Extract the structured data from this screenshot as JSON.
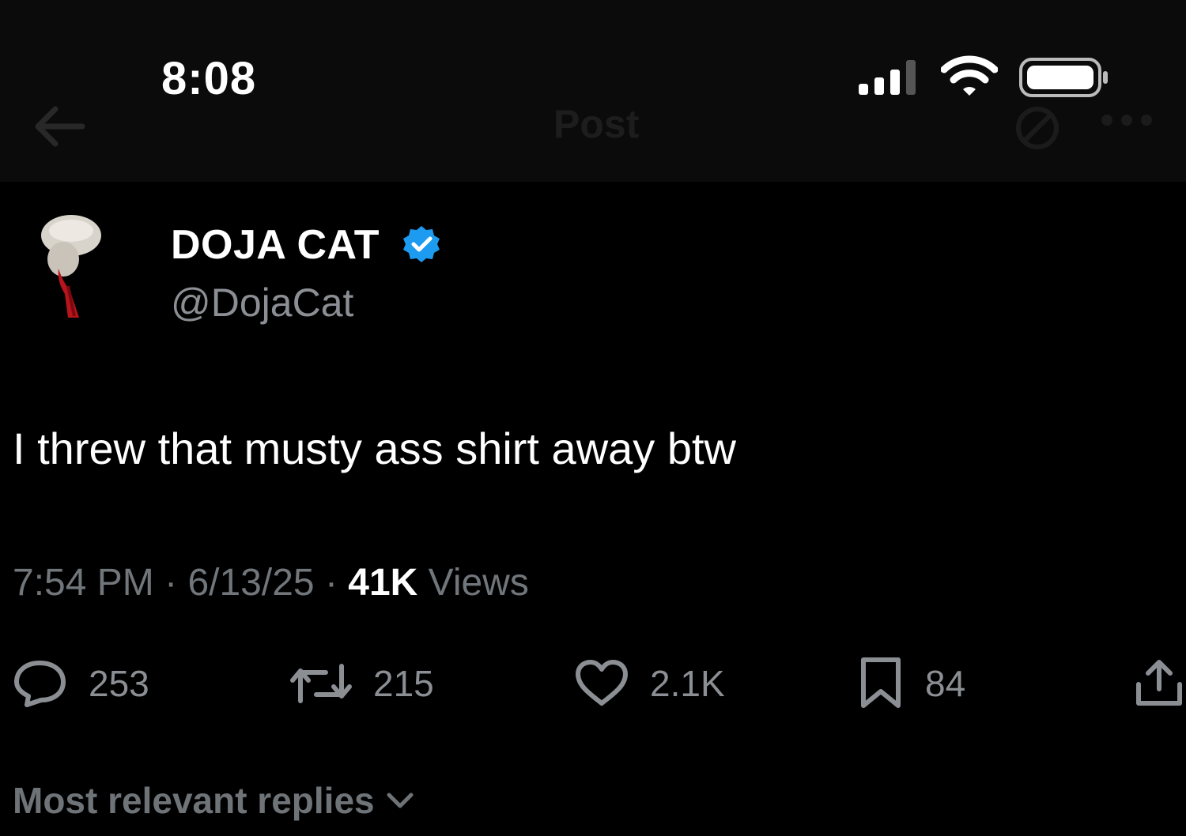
{
  "status_bar": {
    "time": "8:08",
    "icons": [
      "signal-icon",
      "wifi-icon",
      "battery-icon"
    ]
  },
  "nav": {
    "title": "Post",
    "icons": [
      "back-arrow-icon",
      "grok-icon",
      "more-icon"
    ]
  },
  "author": {
    "display_name": "DOJA CAT",
    "handle": "@DojaCat",
    "verified": true,
    "verified_color": "#1d9bf0"
  },
  "tweet": {
    "text": "I threw that musty ass shirt away btw"
  },
  "meta": {
    "time": "7:54 PM",
    "date": "6/13/25",
    "separator": "·",
    "views_count": "41K",
    "views_label": "Views"
  },
  "actions": {
    "reply": {
      "icon": "reply-icon",
      "count": "253"
    },
    "retweet": {
      "icon": "retweet-icon",
      "count": "215"
    },
    "like": {
      "icon": "heart-icon",
      "count": "2.1K"
    },
    "bookmark": {
      "icon": "bookmark-icon",
      "count": "84"
    },
    "share": {
      "icon": "share-icon"
    }
  },
  "replies": {
    "sort_label": "Most relevant replies",
    "icon": "chevron-down-icon"
  },
  "colors": {
    "background": "#000000",
    "text": "#ffffff",
    "muted": "#71767b",
    "accent": "#1d9bf0"
  }
}
